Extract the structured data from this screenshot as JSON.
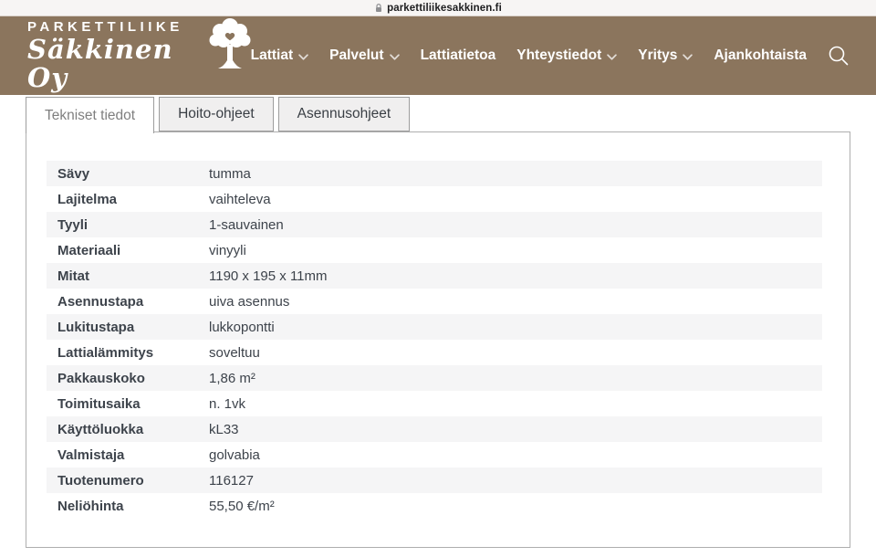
{
  "browser": {
    "url": "parkettiliikesakkinen.fi",
    "lock_icon": "lock-icon"
  },
  "header": {
    "bg_color": "#8b755d",
    "logo": {
      "line1": "PARKETTILIIKE",
      "line2": "Säkkinen Oy",
      "icon": "tree-icon"
    },
    "nav": [
      {
        "label": "Lattiat",
        "dropdown": true
      },
      {
        "label": "Palvelut",
        "dropdown": true
      },
      {
        "label": "Lattiatietoa",
        "dropdown": false
      },
      {
        "label": "Yhteystiedot",
        "dropdown": true
      },
      {
        "label": "Yritys",
        "dropdown": true
      },
      {
        "label": "Ajankohtaista",
        "dropdown": false
      }
    ],
    "search_icon": "search-icon"
  },
  "tabs": [
    {
      "label": "Tekniset tiedot",
      "active": true
    },
    {
      "label": "Hoito-ohjeet",
      "active": false
    },
    {
      "label": "Asennusohjeet",
      "active": false
    }
  ],
  "specs": [
    {
      "label": "Sävy",
      "value": "tumma"
    },
    {
      "label": "Lajitelma",
      "value": "vaihteleva"
    },
    {
      "label": "Tyyli",
      "value": "1-sauvainen"
    },
    {
      "label": "Materiaali",
      "value": "vinyyli"
    },
    {
      "label": "Mitat",
      "value": "1190 x 195 x 11mm"
    },
    {
      "label": "Asennustapa",
      "value": "uiva asennus"
    },
    {
      "label": "Lukitustapa",
      "value": "lukkopontti"
    },
    {
      "label": "Lattialämmitys",
      "value": "soveltuu"
    },
    {
      "label": "Pakkauskoko",
      "value": "1,86 m²"
    },
    {
      "label": "Toimitusaika",
      "value": "n. 1vk"
    },
    {
      "label": "Käyttöluokka",
      "value": "kL33"
    },
    {
      "label": "Valmistaja",
      "value": "golvabia"
    },
    {
      "label": "Tuotenumero",
      "value": "116127"
    },
    {
      "label": "Neliöhinta",
      "value": "55,50 €/m²"
    }
  ],
  "colors": {
    "header_brown": "#8b755d",
    "row_stripe": "#f5f5f6",
    "text_slate": "#3d434b",
    "tab_border": "#9d9d9d",
    "active_tab_text": "#7f7f7f"
  }
}
